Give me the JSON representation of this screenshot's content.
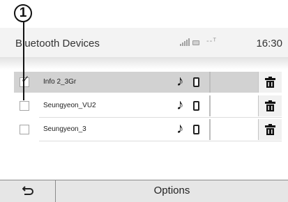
{
  "callout": {
    "number": "1"
  },
  "header": {
    "title": "Bluetooth Devices",
    "network_text": "--ᵀ",
    "time": "16:30"
  },
  "devices": [
    {
      "name": "Info 2_3Gr",
      "checked": true
    },
    {
      "name": "Seungyeon_VU2",
      "checked": false
    },
    {
      "name": "Seungyeon_3",
      "checked": false
    }
  ],
  "row_icons": [
    "music-icon",
    "phone-icon",
    "trash-icon"
  ],
  "footer": {
    "back_icon": "back-arrow-icon",
    "options_label": "Options"
  }
}
